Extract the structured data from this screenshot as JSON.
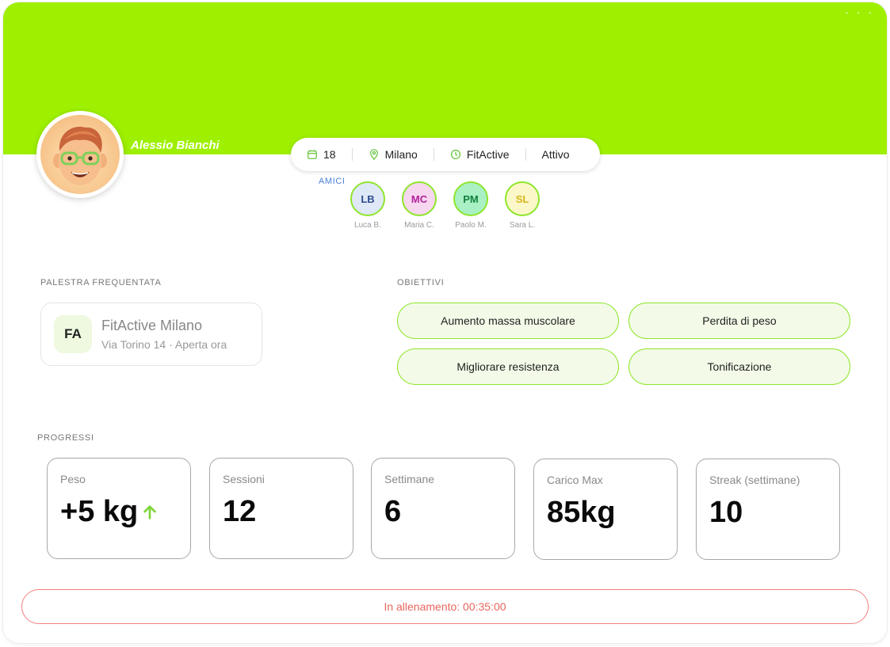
{
  "profile": {
    "name": "Alessio Bianchi",
    "avatar_icon": "memoji-avatar-icon",
    "more_icon": "more-dots-icon",
    "more_label": "· · ·"
  },
  "info": {
    "age": "18",
    "city": "Milano",
    "gym": "FitActive",
    "status": "Attivo",
    "icons": [
      "calendar-icon",
      "location-pin-icon",
      "clock-icon"
    ]
  },
  "friends": {
    "label": "AMICI",
    "items": [
      {
        "initials": "LB",
        "name": "Luca B.",
        "bg": "#dfe8f7",
        "fg": "#2f4c8f"
      },
      {
        "initials": "MC",
        "name": "Maria C.",
        "bg": "#f7d6ef",
        "fg": "#b0239a"
      },
      {
        "initials": "PM",
        "name": "Paolo M.",
        "bg": "#a9f0c4",
        "fg": "#14803e"
      },
      {
        "initials": "SL",
        "name": "Sara L.",
        "bg": "#fbf7c8",
        "fg": "#d8b41a"
      }
    ]
  },
  "gym": {
    "section_label": "PALESTRA FREQUENTATA",
    "logo": "FA",
    "name": "FitActive Milano",
    "subtitle": "Via Torino 14 · Aperta ora"
  },
  "goals": {
    "section_label": "OBIETTIVI",
    "items": [
      "Aumento massa muscolare",
      "Perdita di peso",
      "Migliorare resistenza",
      "Tonificazione"
    ]
  },
  "progress": {
    "section_label": "PROGRESSI",
    "items": [
      {
        "label": "Peso",
        "value": "+5 kg",
        "icon": "arrow-up-icon"
      },
      {
        "label": "Sessioni",
        "value": "12"
      },
      {
        "label": "Settimane",
        "value": "6"
      },
      {
        "label": "Carico Max",
        "value": "85kg"
      },
      {
        "label": "Streak (settimane)",
        "value": "10"
      }
    ]
  },
  "workout": {
    "label": "In allenamento: 00:35:00"
  },
  "colors": {
    "accent": "#9ef000",
    "friend_border": "#8ee62c",
    "workout_red": "#e8665e",
    "arrow_green": "#7ed63a"
  }
}
